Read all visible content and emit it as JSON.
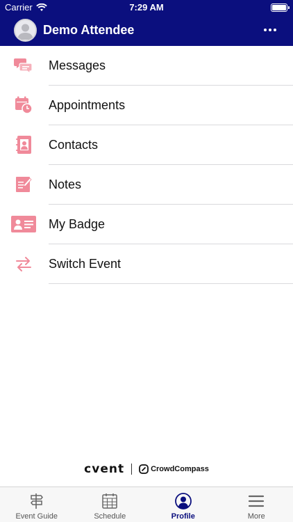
{
  "status_bar": {
    "carrier": "Carrier",
    "time": "7:29 AM"
  },
  "header": {
    "title": "Demo Attendee"
  },
  "menu": {
    "items": [
      {
        "label": "Messages",
        "icon": "messages-icon"
      },
      {
        "label": "Appointments",
        "icon": "appointments-icon"
      },
      {
        "label": "Contacts",
        "icon": "contacts-icon"
      },
      {
        "label": "Notes",
        "icon": "notes-icon"
      },
      {
        "label": "My Badge",
        "icon": "badge-icon"
      },
      {
        "label": "Switch Event",
        "icon": "switch-icon"
      }
    ]
  },
  "brand": {
    "primary": "cvent",
    "secondary": "CrowdCompass"
  },
  "tab_bar": {
    "tabs": [
      {
        "label": "Event Guide",
        "icon": "signpost-icon",
        "active": false
      },
      {
        "label": "Schedule",
        "icon": "calendar-icon",
        "active": false
      },
      {
        "label": "Profile",
        "icon": "profile-icon",
        "active": true
      },
      {
        "label": "More",
        "icon": "menu-icon",
        "active": false
      }
    ]
  },
  "colors": {
    "header_bg": "#0b0f7e",
    "icon_accent": "#f08a9a",
    "active_tab": "#0b0f7e"
  }
}
